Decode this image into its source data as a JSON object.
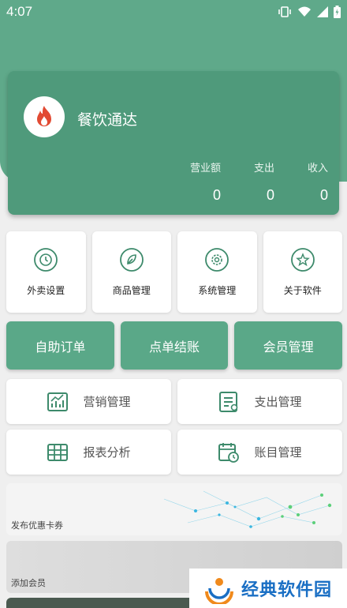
{
  "status_bar": {
    "time": "4:07"
  },
  "header": {
    "app_name": "餐饮通达",
    "stats": [
      {
        "label": "营业额",
        "value": "0"
      },
      {
        "label": "支出",
        "value": "0"
      },
      {
        "label": "收入",
        "value": "0"
      }
    ]
  },
  "settings_tiles": [
    {
      "label": "外卖设置",
      "icon": "clock-icon"
    },
    {
      "label": "商品管理",
      "icon": "leaf-icon"
    },
    {
      "label": "系统管理",
      "icon": "gear-icon"
    },
    {
      "label": "关于软件",
      "icon": "star-icon"
    }
  ],
  "action_buttons": [
    {
      "label": "自助订单"
    },
    {
      "label": "点单结账"
    },
    {
      "label": "会员管理"
    }
  ],
  "management_tiles": [
    {
      "label": "营销管理",
      "icon": "bar-chart-icon"
    },
    {
      "label": "支出管理",
      "icon": "bill-icon"
    },
    {
      "label": "报表分析",
      "icon": "table-icon"
    },
    {
      "label": "账目管理",
      "icon": "calendar-clock-icon"
    }
  ],
  "banners": [
    {
      "label": "发布优惠卡券"
    },
    {
      "label": "添加会员"
    }
  ],
  "watermark": {
    "text": "经典软件园"
  },
  "colors": {
    "primary": "#5fa98a",
    "card": "#4f9a7b",
    "icon": "#3d8a6b"
  }
}
